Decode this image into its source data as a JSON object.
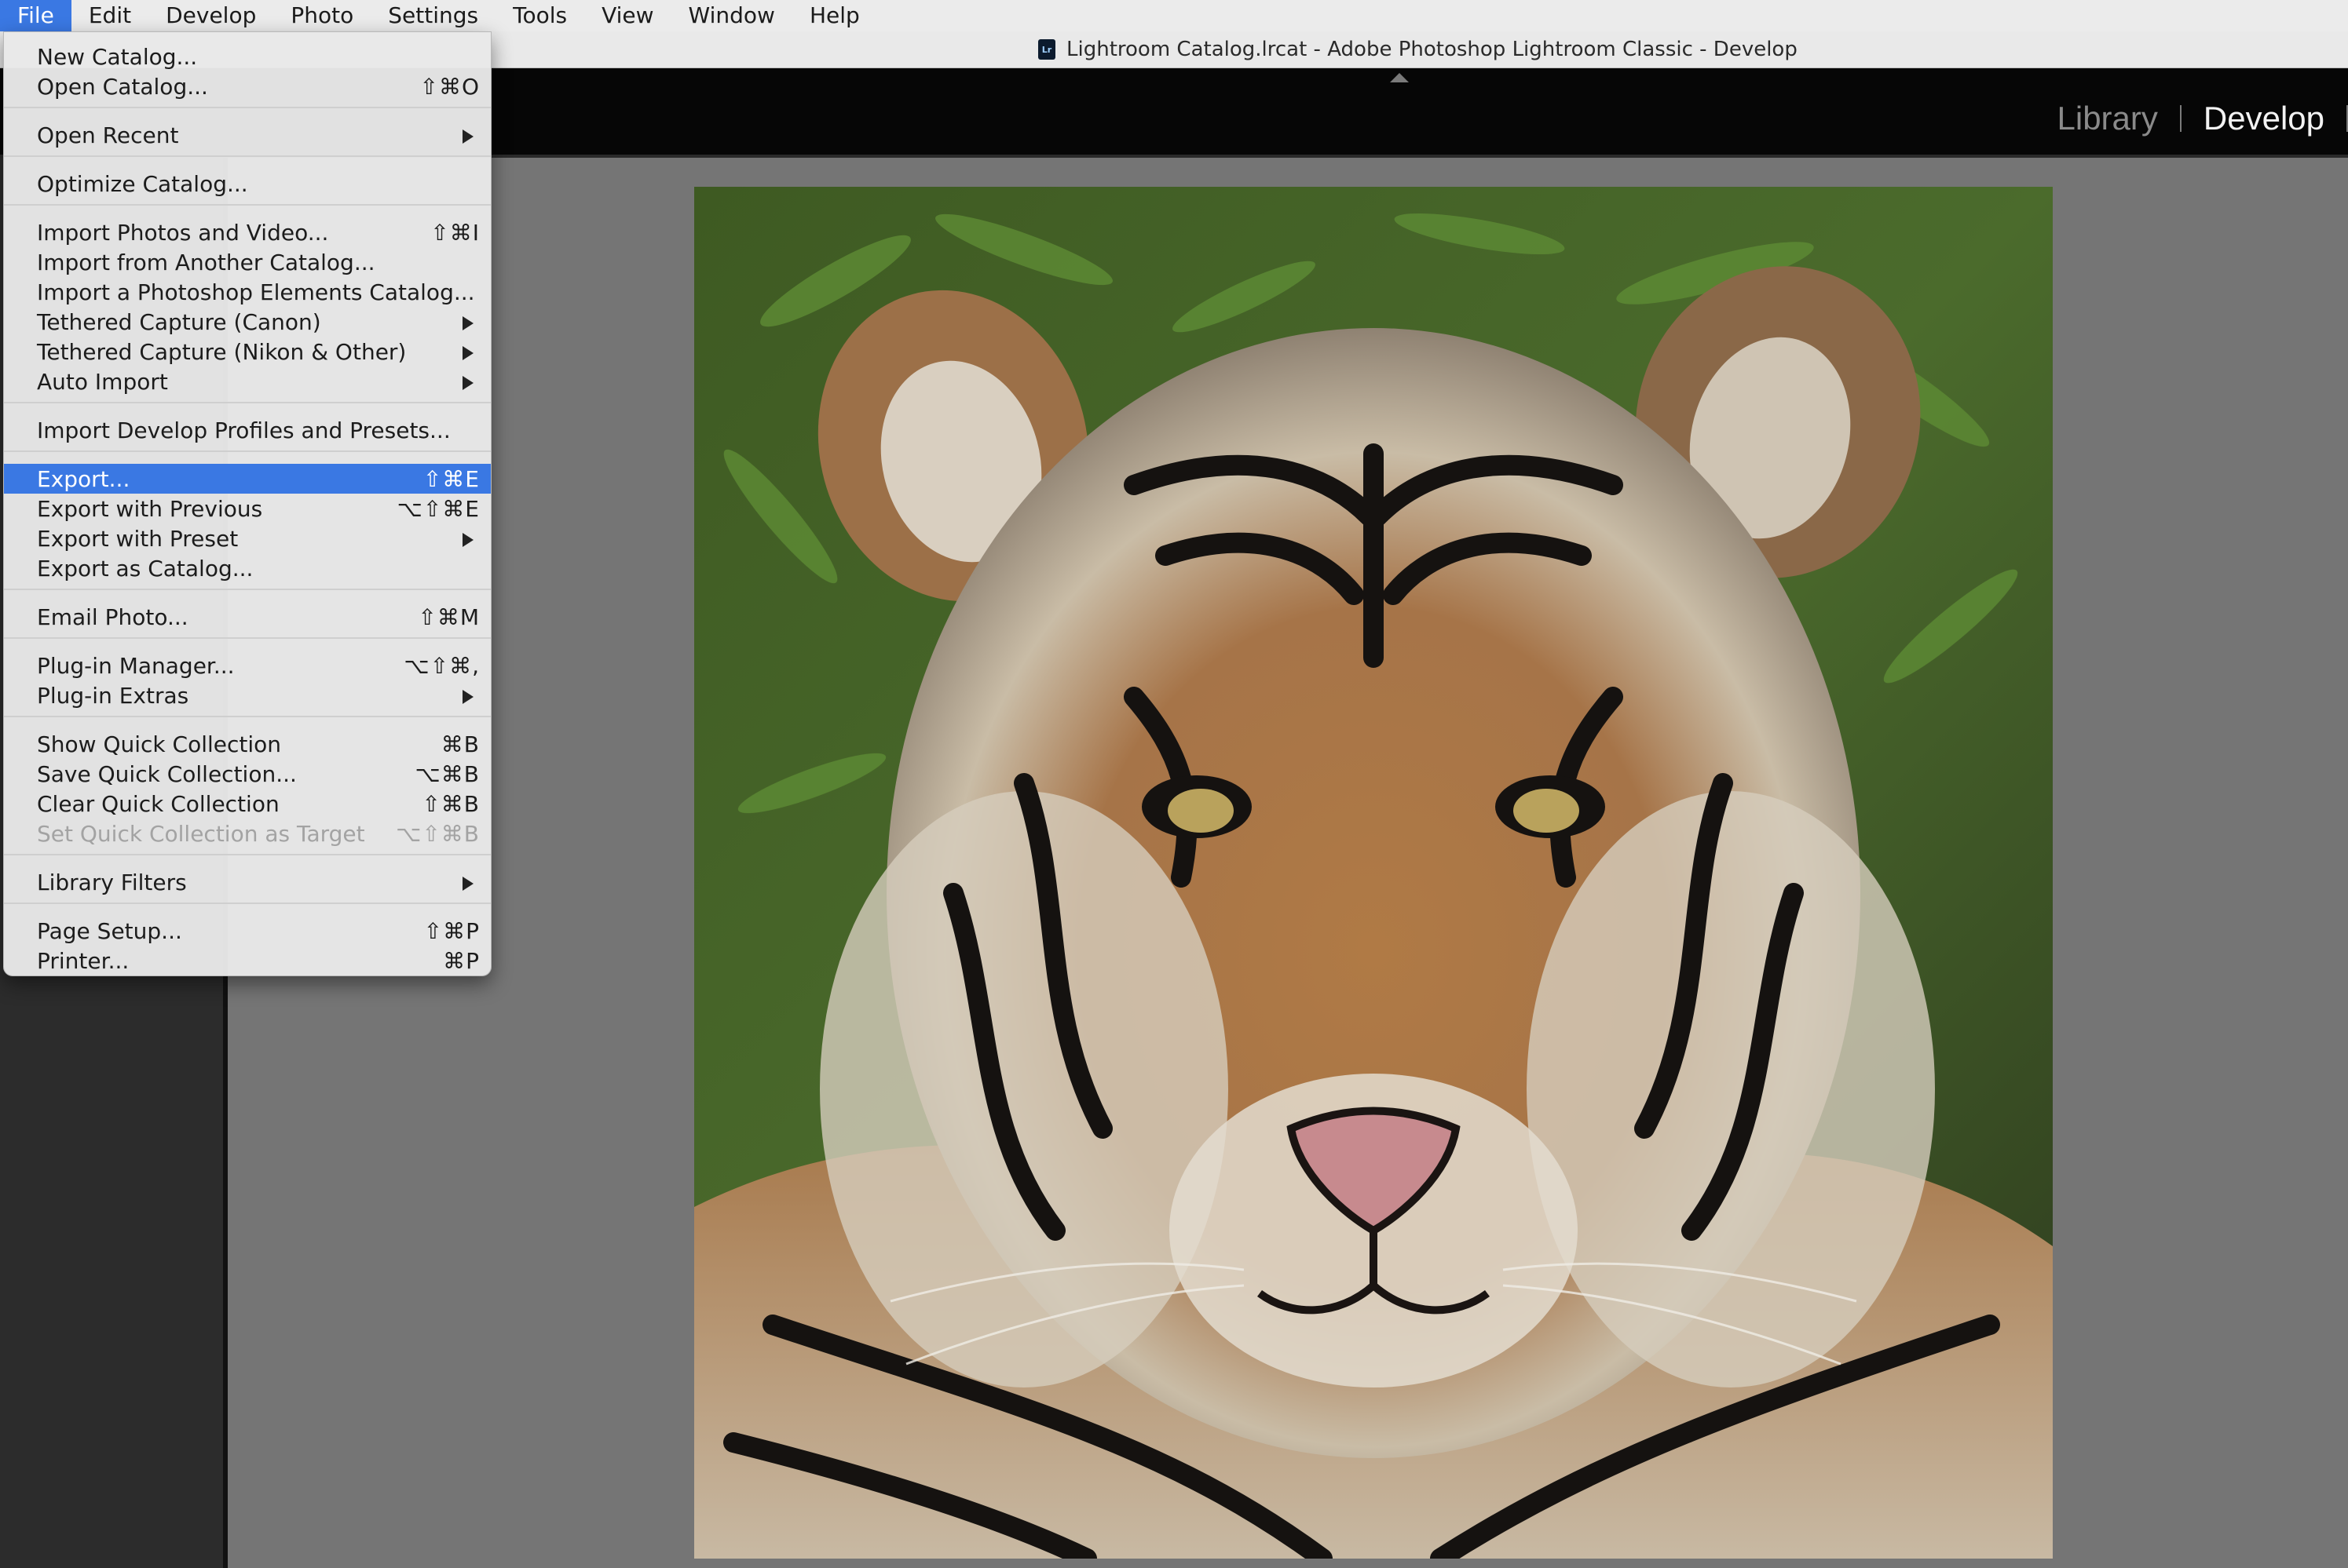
{
  "menubar": {
    "items": [
      "File",
      "Edit",
      "Develop",
      "Photo",
      "Settings",
      "Tools",
      "View",
      "Window",
      "Help"
    ],
    "active": "File"
  },
  "window": {
    "title": "Lightroom Catalog.lrcat - Adobe Photoshop Lightroom Classic - Develop",
    "badge": "Lr"
  },
  "modules": {
    "library": "Library",
    "develop": "Develop",
    "current": "Develop"
  },
  "file_menu": {
    "items": [
      {
        "label": "New Catalog...",
        "shortcut": ""
      },
      {
        "label": "Open Catalog...",
        "shortcut": "⇧⌘O"
      },
      {
        "label": "Open Recent",
        "shortcut": ""
      },
      {
        "label": "Optimize Catalog...",
        "shortcut": ""
      },
      {
        "label": "Import Photos and Video...",
        "shortcut": "⇧⌘I"
      },
      {
        "label": "Import from Another Catalog...",
        "shortcut": ""
      },
      {
        "label": "Import a Photoshop Elements Catalog...",
        "shortcut": ""
      },
      {
        "label": "Tethered Capture (Canon)",
        "shortcut": ""
      },
      {
        "label": "Tethered Capture (Nikon & Other)",
        "shortcut": ""
      },
      {
        "label": "Auto Import",
        "shortcut": ""
      },
      {
        "label": "Import Develop Profiles and Presets...",
        "shortcut": ""
      },
      {
        "label": "Export...",
        "shortcut": "⇧⌘E"
      },
      {
        "label": "Export with Previous",
        "shortcut": "⌥⇧⌘E"
      },
      {
        "label": "Export with Preset",
        "shortcut": ""
      },
      {
        "label": "Export as Catalog...",
        "shortcut": ""
      },
      {
        "label": "Email Photo...",
        "shortcut": "⇧⌘M"
      },
      {
        "label": "Plug-in Manager...",
        "shortcut": "⌥⇧⌘,"
      },
      {
        "label": "Plug-in Extras",
        "shortcut": ""
      },
      {
        "label": "Show Quick Collection",
        "shortcut": "⌘B"
      },
      {
        "label": "Save Quick Collection...",
        "shortcut": "⌥⌘B"
      },
      {
        "label": "Clear Quick Collection",
        "shortcut": "⇧⌘B"
      },
      {
        "label": "Set Quick Collection as Target",
        "shortcut": "⌥⇧⌘B"
      },
      {
        "label": "Library Filters",
        "shortcut": ""
      },
      {
        "label": "Page Setup...",
        "shortcut": "⇧⌘P"
      },
      {
        "label": "Printer...",
        "shortcut": "⌘P"
      }
    ],
    "highlighted": "Export...",
    "disabled": [
      "Set Quick Collection as Target"
    ],
    "submenus": [
      "Open Recent",
      "Tethered Capture (Canon)",
      "Tethered Capture (Nikon & Other)",
      "Auto Import",
      "Export with Preset",
      "Plug-in Extras",
      "Library Filters"
    ]
  },
  "colors": {
    "highlight": "#3a78e3",
    "workspace": "#757575",
    "top_panel": "#060606"
  }
}
